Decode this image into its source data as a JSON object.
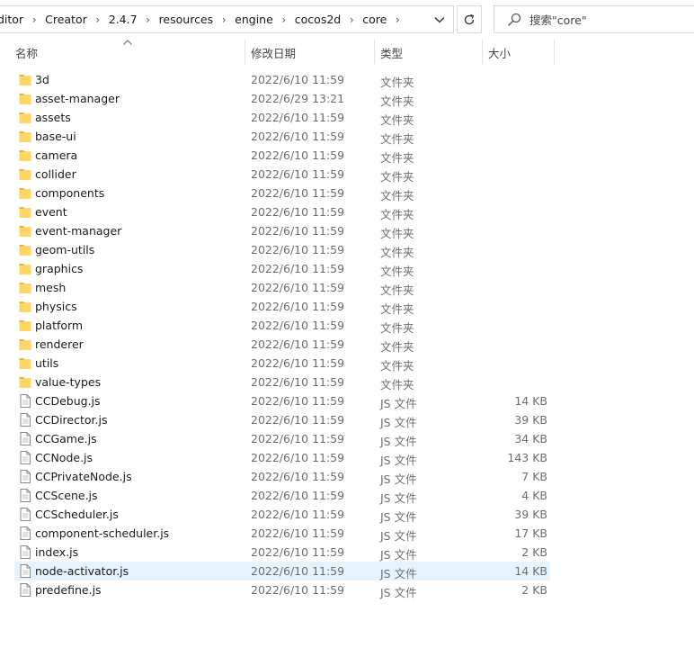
{
  "address_bar": {
    "crumbs": [
      "ditor",
      "Creator",
      "2.4.7",
      "resources",
      "engine",
      "cocos2d",
      "core"
    ]
  },
  "search": {
    "placeholder": "搜索\"core\""
  },
  "columns": {
    "name": "名称",
    "date": "修改日期",
    "type": "类型",
    "size": "大小"
  },
  "files": [
    {
      "name": "3d",
      "date": "2022/6/10 11:59",
      "type": "文件夹",
      "size": "",
      "kind": "folder"
    },
    {
      "name": "asset-manager",
      "date": "2022/6/29 13:21",
      "type": "文件夹",
      "size": "",
      "kind": "folder"
    },
    {
      "name": "assets",
      "date": "2022/6/10 11:59",
      "type": "文件夹",
      "size": "",
      "kind": "folder"
    },
    {
      "name": "base-ui",
      "date": "2022/6/10 11:59",
      "type": "文件夹",
      "size": "",
      "kind": "folder"
    },
    {
      "name": "camera",
      "date": "2022/6/10 11:59",
      "type": "文件夹",
      "size": "",
      "kind": "folder"
    },
    {
      "name": "collider",
      "date": "2022/6/10 11:59",
      "type": "文件夹",
      "size": "",
      "kind": "folder"
    },
    {
      "name": "components",
      "date": "2022/6/10 11:59",
      "type": "文件夹",
      "size": "",
      "kind": "folder"
    },
    {
      "name": "event",
      "date": "2022/6/10 11:59",
      "type": "文件夹",
      "size": "",
      "kind": "folder"
    },
    {
      "name": "event-manager",
      "date": "2022/6/10 11:59",
      "type": "文件夹",
      "size": "",
      "kind": "folder"
    },
    {
      "name": "geom-utils",
      "date": "2022/6/10 11:59",
      "type": "文件夹",
      "size": "",
      "kind": "folder"
    },
    {
      "name": "graphics",
      "date": "2022/6/10 11:59",
      "type": "文件夹",
      "size": "",
      "kind": "folder"
    },
    {
      "name": "mesh",
      "date": "2022/6/10 11:59",
      "type": "文件夹",
      "size": "",
      "kind": "folder"
    },
    {
      "name": "physics",
      "date": "2022/6/10 11:59",
      "type": "文件夹",
      "size": "",
      "kind": "folder"
    },
    {
      "name": "platform",
      "date": "2022/6/10 11:59",
      "type": "文件夹",
      "size": "",
      "kind": "folder"
    },
    {
      "name": "renderer",
      "date": "2022/6/10 11:59",
      "type": "文件夹",
      "size": "",
      "kind": "folder"
    },
    {
      "name": "utils",
      "date": "2022/6/10 11:59",
      "type": "文件夹",
      "size": "",
      "kind": "folder"
    },
    {
      "name": "value-types",
      "date": "2022/6/10 11:59",
      "type": "文件夹",
      "size": "",
      "kind": "folder"
    },
    {
      "name": "CCDebug.js",
      "date": "2022/6/10 11:59",
      "type": "JS 文件",
      "size": "14 KB",
      "kind": "file"
    },
    {
      "name": "CCDirector.js",
      "date": "2022/6/10 11:59",
      "type": "JS 文件",
      "size": "39 KB",
      "kind": "file"
    },
    {
      "name": "CCGame.js",
      "date": "2022/6/10 11:59",
      "type": "JS 文件",
      "size": "34 KB",
      "kind": "file"
    },
    {
      "name": "CCNode.js",
      "date": "2022/6/10 11:59",
      "type": "JS 文件",
      "size": "143 KB",
      "kind": "file"
    },
    {
      "name": "CCPrivateNode.js",
      "date": "2022/6/10 11:59",
      "type": "JS 文件",
      "size": "7 KB",
      "kind": "file"
    },
    {
      "name": "CCScene.js",
      "date": "2022/6/10 11:59",
      "type": "JS 文件",
      "size": "4 KB",
      "kind": "file"
    },
    {
      "name": "CCScheduler.js",
      "date": "2022/6/10 11:59",
      "type": "JS 文件",
      "size": "39 KB",
      "kind": "file"
    },
    {
      "name": "component-scheduler.js",
      "date": "2022/6/10 11:59",
      "type": "JS 文件",
      "size": "17 KB",
      "kind": "file"
    },
    {
      "name": "index.js",
      "date": "2022/6/10 11:59",
      "type": "JS 文件",
      "size": "2 KB",
      "kind": "file"
    },
    {
      "name": "node-activator.js",
      "date": "2022/6/10 11:59",
      "type": "JS 文件",
      "size": "14 KB",
      "kind": "file",
      "highlighted": true
    },
    {
      "name": "predefine.js",
      "date": "2022/6/10 11:59",
      "type": "JS 文件",
      "size": "2 KB",
      "kind": "file"
    }
  ],
  "colors": {
    "folder_fill": "#ffd663",
    "folder_dark": "#e8b43c",
    "hover_row": "#e5f3ff",
    "secondary_text": "#6d6d6d"
  }
}
